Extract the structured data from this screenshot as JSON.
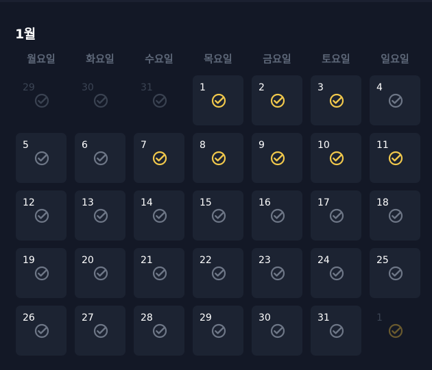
{
  "calendar": {
    "month_title": "1월",
    "weekdays": [
      "월요일",
      "화요일",
      "수요일",
      "목요일",
      "금요일",
      "토요일",
      "일요일"
    ],
    "colors": {
      "checked": "#f2c94c",
      "unchecked": "#6e7787",
      "cell_bg": "#1c2332",
      "background": "#131826"
    },
    "icon": "check-circle-icon",
    "weeks": [
      [
        {
          "day": "29",
          "outside": true,
          "checked": false
        },
        {
          "day": "30",
          "outside": true,
          "checked": false
        },
        {
          "day": "31",
          "outside": true,
          "checked": false
        },
        {
          "day": "1",
          "outside": false,
          "checked": true
        },
        {
          "day": "2",
          "outside": false,
          "checked": true
        },
        {
          "day": "3",
          "outside": false,
          "checked": true
        },
        {
          "day": "4",
          "outside": false,
          "checked": false
        }
      ],
      [
        {
          "day": "5",
          "outside": false,
          "checked": false
        },
        {
          "day": "6",
          "outside": false,
          "checked": false
        },
        {
          "day": "7",
          "outside": false,
          "checked": true
        },
        {
          "day": "8",
          "outside": false,
          "checked": true
        },
        {
          "day": "9",
          "outside": false,
          "checked": true
        },
        {
          "day": "10",
          "outside": false,
          "checked": true
        },
        {
          "day": "11",
          "outside": false,
          "checked": true
        }
      ],
      [
        {
          "day": "12",
          "outside": false,
          "checked": false
        },
        {
          "day": "13",
          "outside": false,
          "checked": false
        },
        {
          "day": "14",
          "outside": false,
          "checked": false
        },
        {
          "day": "15",
          "outside": false,
          "checked": false
        },
        {
          "day": "16",
          "outside": false,
          "checked": false
        },
        {
          "day": "17",
          "outside": false,
          "checked": false
        },
        {
          "day": "18",
          "outside": false,
          "checked": false
        }
      ],
      [
        {
          "day": "19",
          "outside": false,
          "checked": false
        },
        {
          "day": "20",
          "outside": false,
          "checked": false
        },
        {
          "day": "21",
          "outside": false,
          "checked": false
        },
        {
          "day": "22",
          "outside": false,
          "checked": false
        },
        {
          "day": "23",
          "outside": false,
          "checked": false
        },
        {
          "day": "24",
          "outside": false,
          "checked": false
        },
        {
          "day": "25",
          "outside": false,
          "checked": false
        }
      ],
      [
        {
          "day": "26",
          "outside": false,
          "checked": false
        },
        {
          "day": "27",
          "outside": false,
          "checked": false
        },
        {
          "day": "28",
          "outside": false,
          "checked": false
        },
        {
          "day": "29",
          "outside": false,
          "checked": false
        },
        {
          "day": "30",
          "outside": false,
          "checked": false
        },
        {
          "day": "31",
          "outside": false,
          "checked": false
        },
        {
          "day": "1",
          "outside": true,
          "checked": true
        }
      ]
    ]
  }
}
